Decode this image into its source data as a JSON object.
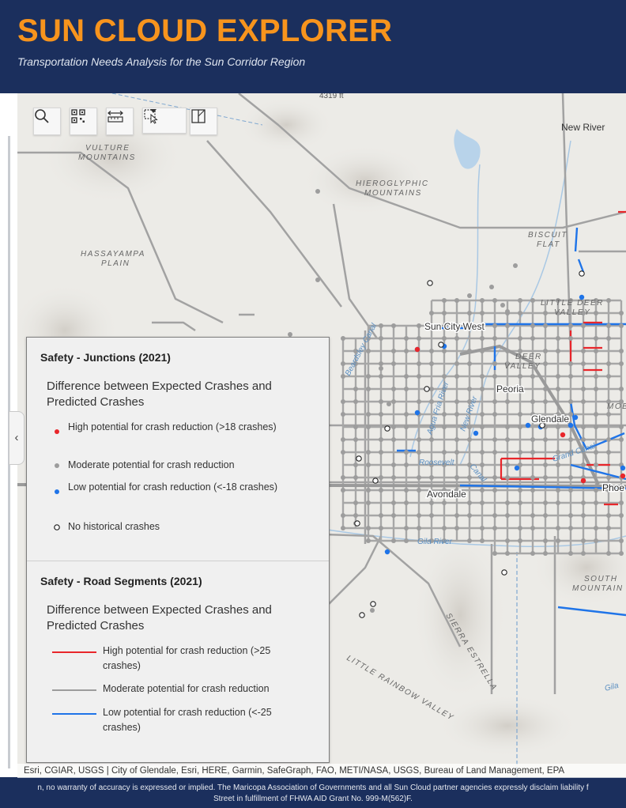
{
  "header": {
    "title": "SUN CLOUD EXPLORER",
    "subtitle": "Transportation Needs Analysis for the Sun Corridor Region"
  },
  "colors": {
    "header_bg": "#1b2f5d",
    "title_orange": "#f7941d",
    "high_potential_red": "#e8262b",
    "moderate_gray": "#9c9c9c",
    "low_potential_blue": "#1f74e8"
  },
  "toolbar": {
    "tools": [
      {
        "name": "search-tool",
        "icon": "search-icon"
      },
      {
        "name": "basemap-gallery-tool",
        "icon": "qr-grid-icon"
      },
      {
        "name": "measure-tool",
        "icon": "ruler-icon"
      },
      {
        "name": "select-tool",
        "icon": "select-cursor-icon"
      },
      {
        "name": "select-options-tool",
        "icon": "caret-down-icon"
      },
      {
        "name": "swipe-tool",
        "icon": "swipe-icon"
      }
    ]
  },
  "map_labels": {
    "elevation": "4319 ft",
    "new_river": "New River",
    "vulture_1": "VULTURE",
    "vulture_2": "MOUNTAINS",
    "hieroglyphic_1": "HIEROGLYPHIC",
    "hieroglyphic_2": "MOUNTAINS",
    "biscuit_1": "BISCUIT",
    "biscuit_2": "FLAT",
    "hassayampa_1": "HASSAYAMPA",
    "hassayampa_2": "PLAIN",
    "little_deer_1": "LITTLE DEER",
    "little_deer_2": "VALLEY",
    "sun_city_west": "Sun City West",
    "beardsley_canal": "Beardsley Canal",
    "deer_valley_1": "DEER",
    "deer_valley_2": "VALLEY",
    "agua_fria": "Agua Fria River",
    "new_river_2": "New River",
    "peoria": "Peoria",
    "glendale": "Glendale",
    "grand_canal": "Grand Canal",
    "roosevelt": "Roosevelt",
    "canal": "Canal",
    "avondale": "Avondale",
    "phoenix": "Phoe",
    "gila_river": "Gila River",
    "south_mountain_1": "SOUTH",
    "south_mountain_2": "MOUNTAIN",
    "sierra_estrella": "SIERRA ESTRELLA",
    "little_rainbow": "LITTLE RAINBOW VALLEY",
    "gila_right": "Gila",
    "mob": "MOB"
  },
  "legend": {
    "junctions": {
      "title": "Safety - Junctions (2021)",
      "subtitle": "Difference between Expected Crashes and Predicted Crashes",
      "items": [
        {
          "label": "High potential for crash reduction (>18 crashes)",
          "symbol": "red-dot"
        },
        {
          "label": "Moderate potential for crash reduction",
          "symbol": "gray-dot"
        },
        {
          "label": "Low potential for crash reduction (<-18 crashes)",
          "symbol": "blue-dot"
        },
        {
          "label": "No historical crashes",
          "symbol": "hollow-dot"
        }
      ]
    },
    "segments": {
      "title": "Safety - Road Segments (2021)",
      "subtitle": "Difference between Expected Crashes and Predicted Crashes",
      "items": [
        {
          "label": "High potential for crash reduction (>25 crashes)",
          "symbol": "red-line"
        },
        {
          "label": "Moderate potential for crash reduction",
          "symbol": "gray-line"
        },
        {
          "label": "Low potential for crash reduction (<-25 crashes)",
          "symbol": "blue-line"
        }
      ]
    }
  },
  "attribution": "Esri, CGIAR, USGS | City of Glendale, Esri, HERE, Garmin, SafeGraph, FAO, METI/NASA, USGS, Bureau of Land Management, EPA",
  "footer": {
    "line1": "n, no warranty of accuracy is expressed or implied. The Maricopa Association of Governments and all Sun Cloud partner agencies expressly disclaim liability f",
    "line2": "Street in fulfillment of FHWA AID Grant No. 999-M(562)F."
  }
}
